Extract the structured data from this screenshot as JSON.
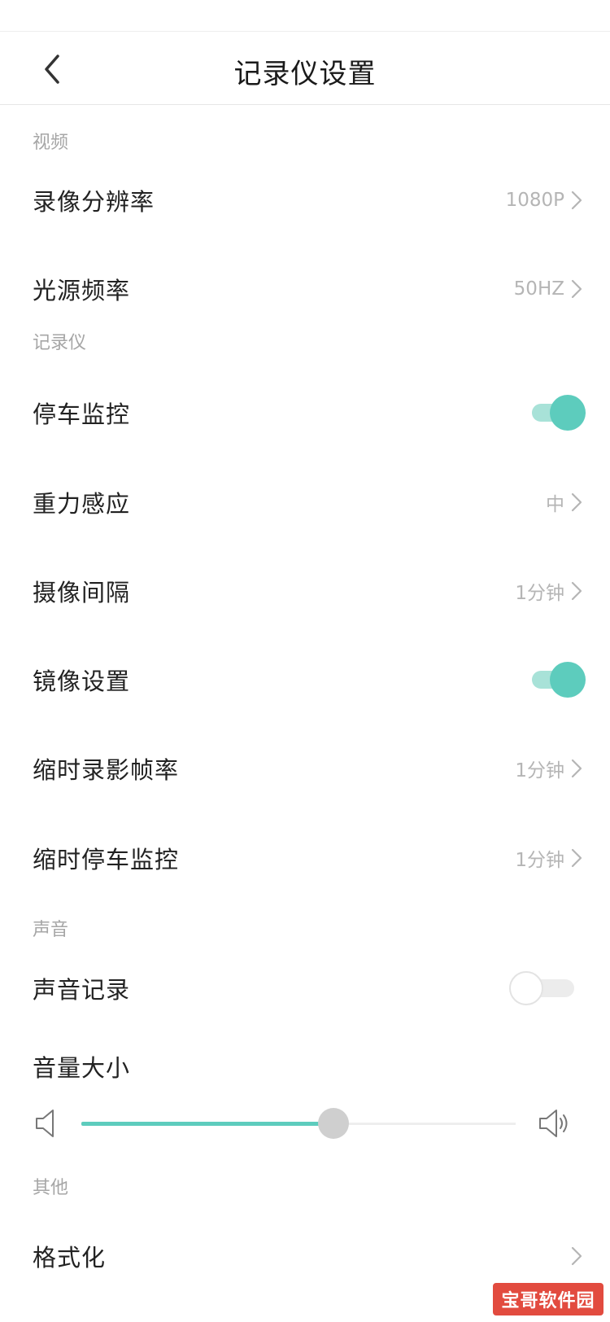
{
  "header": {
    "title": "记录仪设置"
  },
  "sections": {
    "video": "视频",
    "recorder": "记录仪",
    "sound": "声音",
    "other": "其他"
  },
  "rows": {
    "resolution": {
      "label": "录像分辨率",
      "value": "1080P"
    },
    "light_freq": {
      "label": "光源频率",
      "value": "50HZ"
    },
    "parking_monitor": {
      "label": "停车监控",
      "enabled": true
    },
    "gsensor": {
      "label": "重力感应",
      "value": "中"
    },
    "interval": {
      "label": "摄像间隔",
      "value": "1分钟"
    },
    "mirror": {
      "label": "镜像设置",
      "enabled": true
    },
    "timelapse_rate": {
      "label": "缩时录影帧率",
      "value": "1分钟"
    },
    "timelapse_parking": {
      "label": "缩时停车监控",
      "value": "1分钟"
    },
    "sound_record": {
      "label": "声音记录",
      "enabled": false
    },
    "volume": {
      "label": "音量大小",
      "level_percent": 58
    },
    "format": {
      "label": "格式化"
    }
  },
  "watermark": {
    "text": "宝哥软件园"
  },
  "colors": {
    "accent": "#5dccbd",
    "accent_light": "#a8e2d8",
    "watermark_bg": "#e24b3f"
  },
  "icons": {
    "back": "chevron-left-icon",
    "chevron": "chevron-right-icon",
    "volume_low": "volume-low-icon",
    "volume_high": "volume-high-icon"
  }
}
